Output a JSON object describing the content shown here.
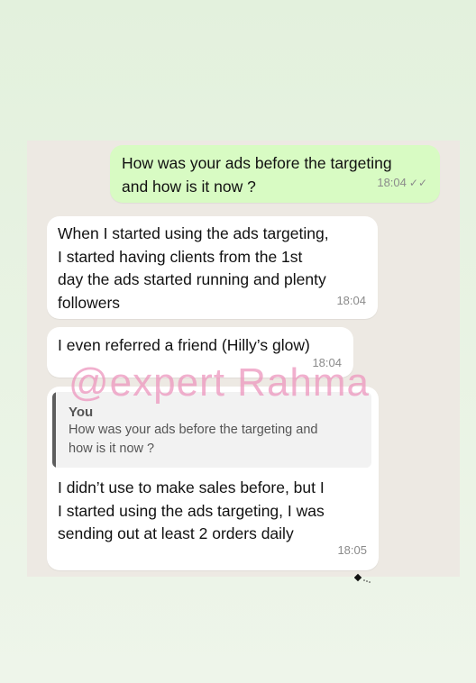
{
  "messages": [
    {
      "text_lines": [
        "How was your ads before the targeting",
        "and how is it now ?"
      ],
      "time": "18:04",
      "status": "✓✓"
    },
    {
      "text_lines": [
        "When I started using the ads targeting,",
        "I started having clients from the 1st",
        "day the ads started running and plenty",
        "followers"
      ],
      "time": "18:04"
    },
    {
      "text_lines": [
        "I even referred a friend (Hilly’s glow)"
      ],
      "time": "18:04"
    },
    {
      "reply": {
        "author": "You",
        "text_lines": [
          "How was your ads before the targeting and",
          "how is it now ?"
        ]
      },
      "text_lines": [
        "I didn’t use to make sales before, but I",
        "I started using the ads targeting, I was",
        "sending out at least 2 orders daily"
      ],
      "time": "18:05"
    }
  ],
  "watermark": "@expert Rahma",
  "icons": {
    "cursor": "mouse-cursor-icon",
    "read_ticks": "double-check-icon"
  }
}
